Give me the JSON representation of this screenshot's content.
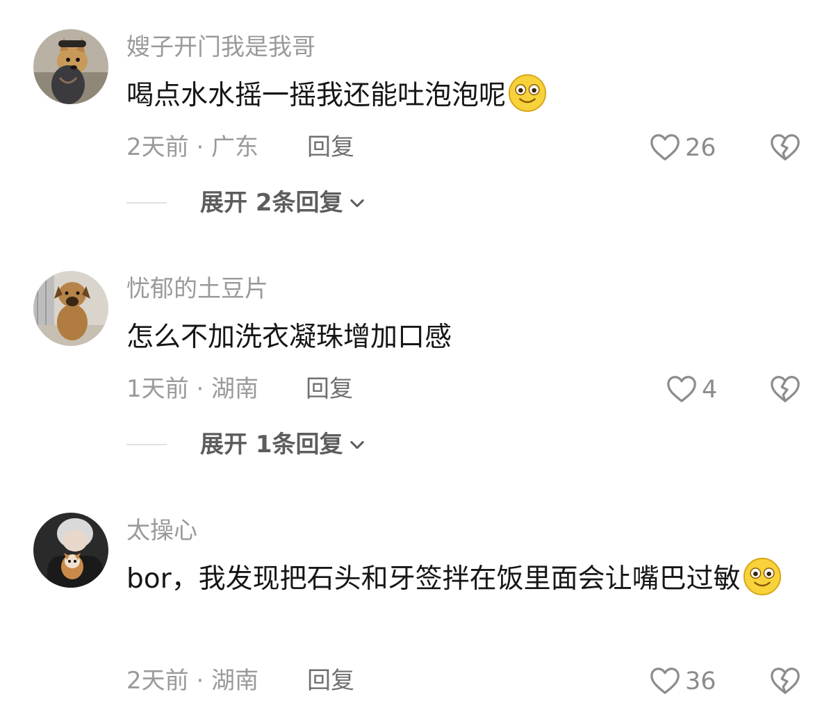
{
  "comments": [
    {
      "username": "嫂子开门我是我哥",
      "text": "喝点水水摇一摇我还能吐泡泡呢",
      "emoji": "smile-emoji",
      "time": "2天前 · 广东",
      "reply": "回复",
      "likes": "26",
      "expand": "展开 2条回复"
    },
    {
      "username": "忧郁的土豆片",
      "text": "怎么不加洗衣凝珠增加口感",
      "time": "1天前 · 湖南",
      "reply": "回复",
      "likes": "4",
      "expand": "展开 1条回复"
    },
    {
      "username": "太操心",
      "text": "bor，我发现把石头和牙签拌在饭里面会让嘴巴过敏",
      "emoji": "smile-emoji",
      "time": "2天前 · 湖南",
      "reply": "回复",
      "likes": "36"
    }
  ],
  "icons": {
    "like": "heart-outline-icon",
    "dislike": "broken-heart-icon",
    "expand": "chevron-down-icon"
  },
  "colors": {
    "username": "#9a9a9a",
    "text": "#161616",
    "meta": "#9a9a9a",
    "reply": "#6f6f6f",
    "icon": "#8c8c8c"
  }
}
